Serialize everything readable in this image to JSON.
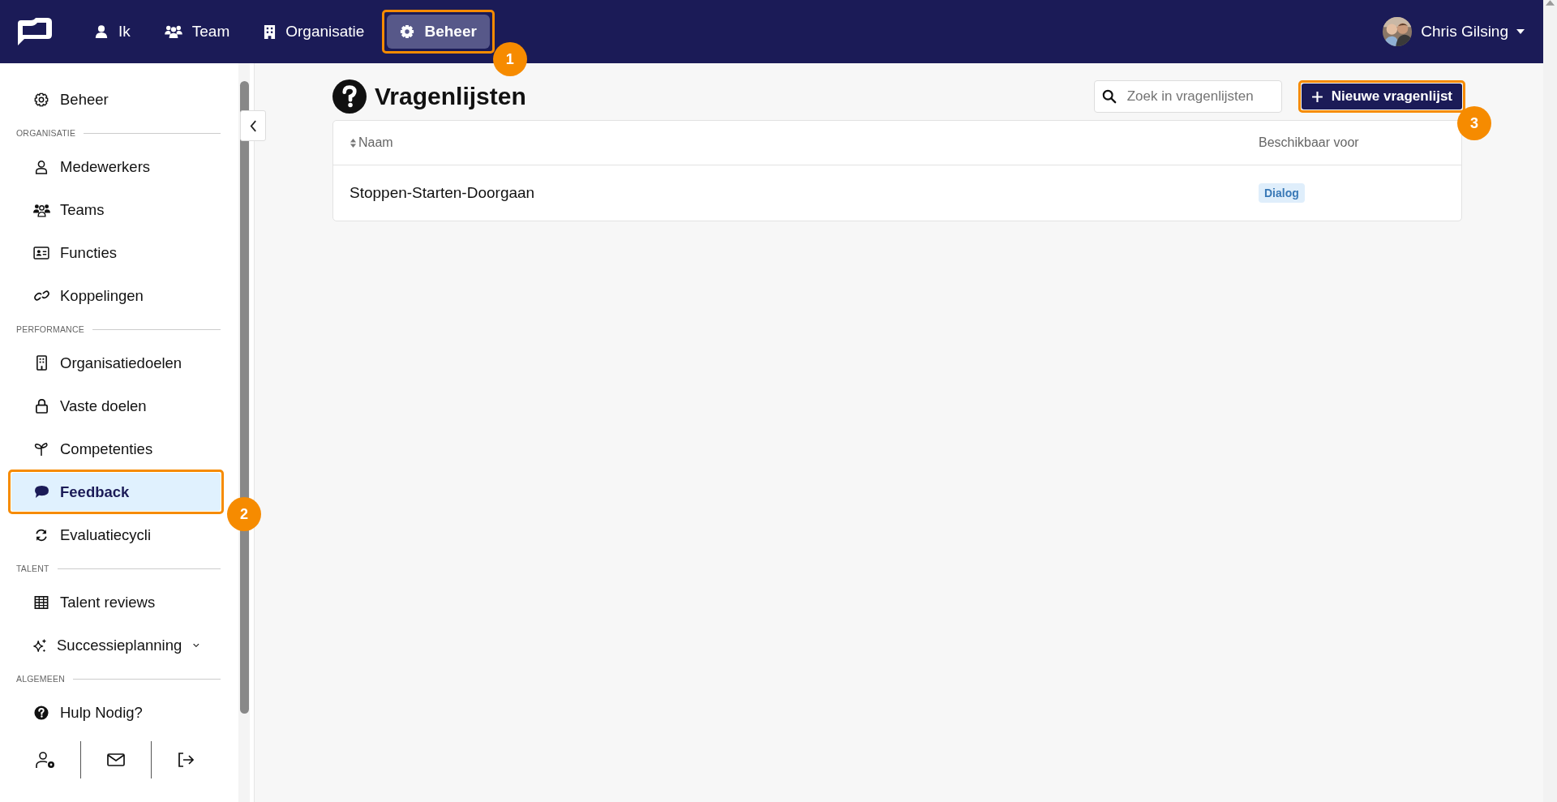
{
  "topbar": {
    "nav": [
      {
        "label": "Ik",
        "selected": false
      },
      {
        "label": "Team",
        "selected": false
      },
      {
        "label": "Organisatie",
        "selected": false
      },
      {
        "label": "Beheer",
        "selected": true,
        "callout": "1"
      }
    ],
    "user": {
      "name": "Chris Gilsing"
    }
  },
  "sidebar": {
    "sections": [
      {
        "items": [
          {
            "label": "Beheer",
            "selected": false
          }
        ]
      },
      {
        "title": "ORGANISATIE",
        "items": [
          {
            "label": "Medewerkers",
            "selected": false
          },
          {
            "label": "Teams",
            "selected": false
          },
          {
            "label": "Functies",
            "selected": false
          },
          {
            "label": "Koppelingen",
            "selected": false
          }
        ]
      },
      {
        "title": "PERFORMANCE",
        "items": [
          {
            "label": "Organisatiedoelen",
            "selected": false
          },
          {
            "label": "Vaste doelen",
            "selected": false
          },
          {
            "label": "Competenties",
            "selected": false
          },
          {
            "label": "Feedback",
            "selected": true,
            "callout": "2"
          },
          {
            "label": "Evaluatiecycli",
            "selected": false
          }
        ]
      },
      {
        "title": "TALENT",
        "items": [
          {
            "label": "Talent reviews",
            "selected": false
          },
          {
            "label": "Successieplanning",
            "selected": false,
            "expandable": true
          }
        ]
      },
      {
        "title": "ALGEMEEN",
        "items": [
          {
            "label": "Hulp Nodig?",
            "selected": false
          }
        ]
      }
    ]
  },
  "page": {
    "title": "Vragenlijsten",
    "search": {
      "placeholder": "Zoek in vragenlijsten"
    },
    "new_button": {
      "label": "Nieuwe vragenlijst",
      "callout": "3"
    },
    "table": {
      "columns": [
        "Naam",
        "Beschikbaar voor"
      ],
      "rows": [
        {
          "name": "Stoppen-Starten-Doorgaan",
          "tag": "Dialog"
        }
      ]
    }
  }
}
